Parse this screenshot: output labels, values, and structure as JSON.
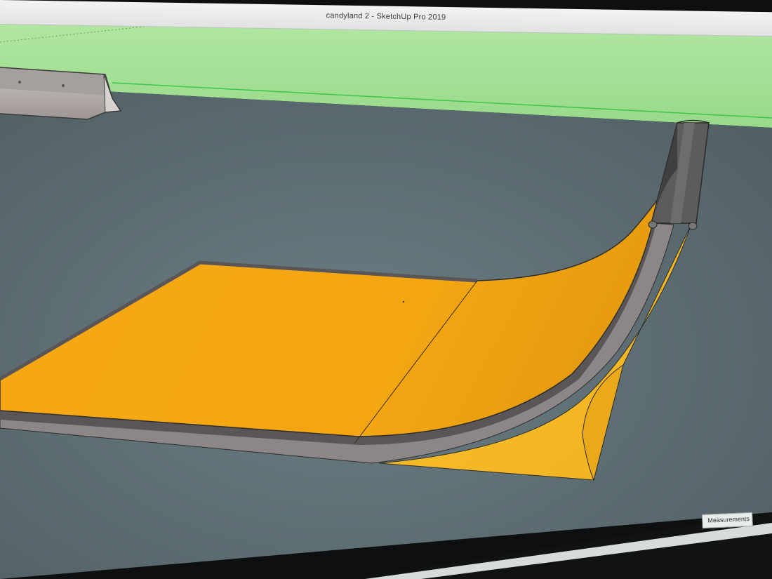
{
  "window": {
    "title": "candyland 2 - SketchUp Pro 2019"
  },
  "status_bar": {
    "measurements_label": "Measurements"
  },
  "colors": {
    "sky": "#a6e295",
    "ground": "#5b6c72",
    "ramp_surface": "#f2a91c",
    "ramp_side": "#f5bd29",
    "coping": "#4d4d4e",
    "deck_edge": "#8c8687",
    "horizon_line": "#3fc54a"
  },
  "icons": {
    "barrier": "jersey-barrier-model",
    "ramp": "quarter-pipe-ramp-model"
  }
}
